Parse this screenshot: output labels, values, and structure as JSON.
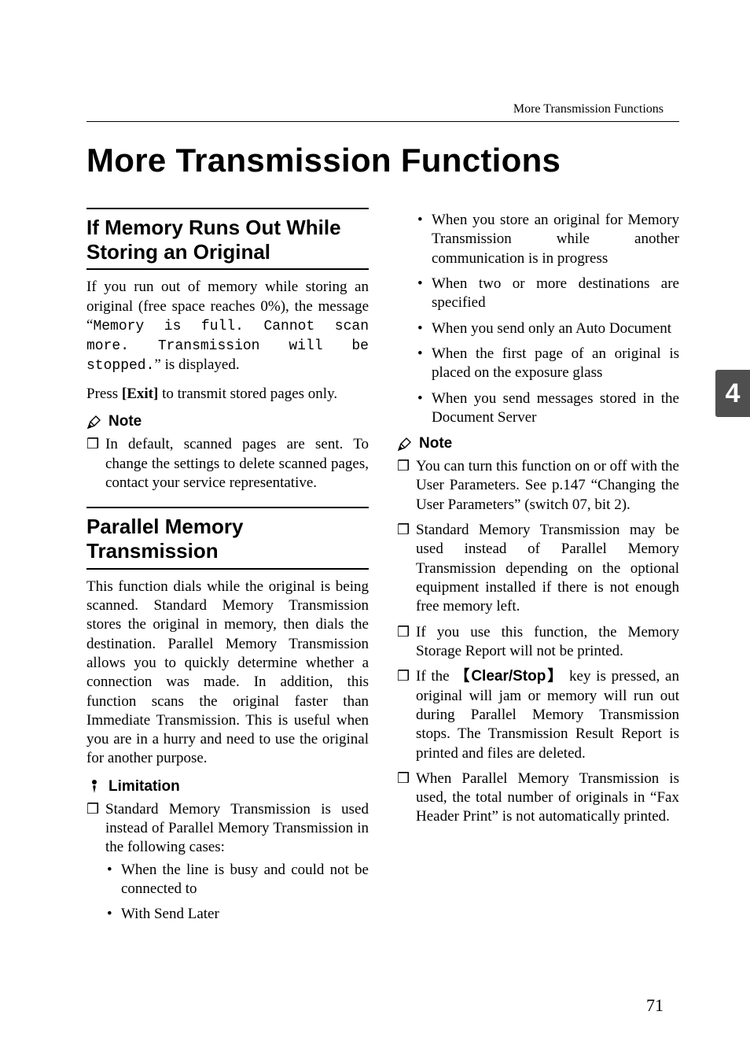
{
  "running_head": "More Transmission Functions",
  "chapter_title": "More Transmission Functions",
  "tab": "4",
  "page_number": "71",
  "left": {
    "sect1_title": "If Memory Runs Out While Storing an Original",
    "sect1_p1_a": "If you run out of memory while storing an original (free space reaches 0%), the message “",
    "sect1_p1_mono": "Memory is full. Cannot scan more. Transmission will be stopped.",
    "sect1_p1_b": "” is displayed.",
    "sect1_p2_a": "Press ",
    "sect1_p2_key": "[Exit]",
    "sect1_p2_b": " to transmit stored pages only.",
    "note_label": "Note",
    "sect1_note1": "In default, scanned pages are sent. To change the settings to delete scanned pages, contact your service representative.",
    "sect2_title": "Parallel Memory Transmission",
    "sect2_p1": "This function dials while the original is being scanned. Standard Memory Transmission stores the original in memory, then dials the destination. Parallel Memory Transmission allows you to quickly determine whether a connection was made. In addition, this function scans the original faster than Immediate Transmission. This is useful when you are in a hurry and need to use the original for another purpose.",
    "lim_label": "Limitation",
    "lim_item": "Standard Memory Transmission is used instead of Parallel Memory Transmission in the following cases:",
    "lim_sub1": "When the line is busy and could not be connected to",
    "lim_sub2": "With Send Later"
  },
  "right": {
    "cont_sub1": "When you store an original for Memory Transmission while another communication is in progress",
    "cont_sub2": "When two or more destinations are specified",
    "cont_sub3": "When you send only an Auto Document",
    "cont_sub4": "When the first page of an original is placed on the exposure glass",
    "cont_sub5": "When you send messages stored in the Document Server",
    "note_label": "Note",
    "n1": "You can turn this function on or off with the User Parameters. See p.147 “Changing the User Parameters” (switch 07, bit 2).",
    "n2": "Standard Memory Transmission may be used instead of Parallel Memory Transmission depending on the optional equipment installed if there is not enough free memory left.",
    "n3": "If you use this function, the Memory Storage Report will not be printed.",
    "n4_a": "If the ",
    "n4_key": "Clear/Stop",
    "n4_b": " key is pressed, an original will jam or memory will run out during Parallel Memory Transmission stops. The Transmission Result Report is printed and files are deleted.",
    "n5": "When Parallel Memory Transmission is used, the total number of originals in “Fax Header Print” is not automatically printed."
  }
}
